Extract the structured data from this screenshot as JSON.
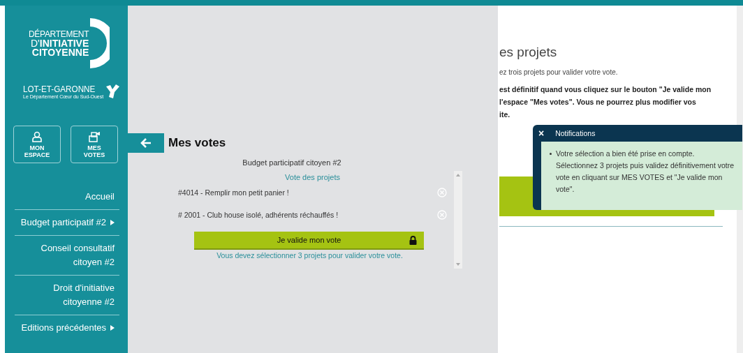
{
  "logo": {
    "line1": "DÉPARTEMENT",
    "line2": "D'",
    "line2_bold": "INITIATIVE",
    "line3": "CITOYENNE",
    "brand": "LOT-ET-GARONNE",
    "tagline": "Le Département Cœur du Sud-Ouest"
  },
  "account_buttons": [
    {
      "kind": "user",
      "label": "MON ESPACE"
    },
    {
      "kind": "ballot",
      "label": "MES VOTES"
    }
  ],
  "nav": [
    {
      "label": "Accueil",
      "has_submenu": false
    },
    {
      "label": "Budget participatif #2",
      "has_submenu": true
    },
    {
      "label": "Conseil consultatif citoyen #2",
      "has_submenu": false
    },
    {
      "label": "Droit d'initiative citoyenne #2",
      "has_submenu": false
    },
    {
      "label": "Editions précédentes",
      "has_submenu": true
    }
  ],
  "votes_panel": {
    "title": "Mes votes",
    "subtitle": "Budget participatif citoyen #2",
    "section": "Vote des projets",
    "items": [
      {
        "label": "#4014 - Remplir mon petit panier !"
      },
      {
        "label": "# 2001 - Club house isolé, adhérents réchauffés !"
      }
    ],
    "validate_button": {
      "label": "Je valide mon vote",
      "locked": true
    },
    "hint": "Vous devez sélectionner 3 projets pour valider votre vote."
  },
  "page": {
    "heading": "es projets",
    "intro": "ez trois projets pour valider votre vote.",
    "warning_lines": [
      "est définitif quand vous cliquez sur le bouton \"Je valide mon",
      "l'espace \"Mes votes\". Vous ne pourrez plus modifier vos",
      "ite."
    ]
  },
  "notification": {
    "close": "×",
    "title": "Notifications",
    "message": "Votre sélection a bien été prise en compte. Sélectionnez 3 projets puis validez définitivement votre vote en cliquant sur MES VOTES et \"Je valide mon vote\"."
  }
}
